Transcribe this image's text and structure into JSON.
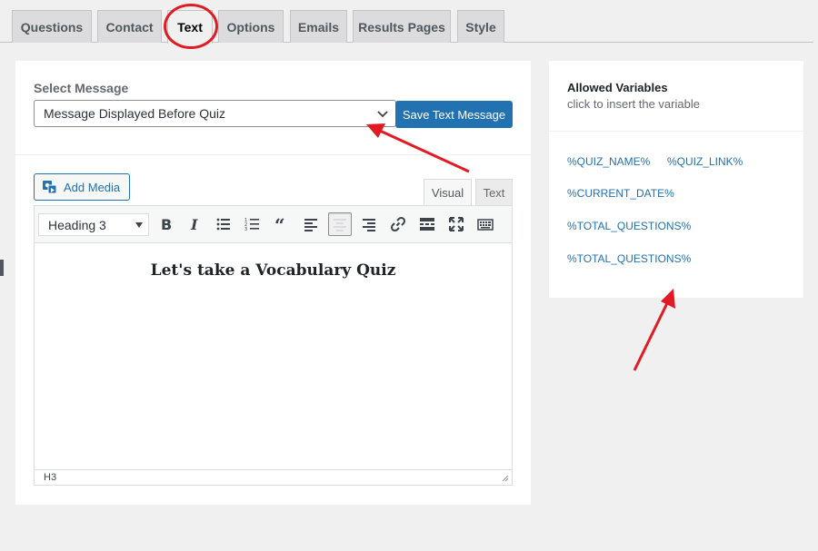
{
  "tabs": [
    {
      "label": "Questions",
      "active": false
    },
    {
      "label": "Contact",
      "active": false
    },
    {
      "label": "Text",
      "active": true
    },
    {
      "label": "Options",
      "active": false
    },
    {
      "label": "Emails",
      "active": false
    },
    {
      "label": "Results Pages",
      "active": false
    },
    {
      "label": "Style",
      "active": false
    }
  ],
  "message_section": {
    "label": "Select Message",
    "selected_value": "Message Displayed Before Quiz",
    "save_label": "Save Text Message"
  },
  "editor": {
    "add_media_label": "Add Media",
    "mode_visual": "Visual",
    "mode_text": "Text",
    "format_value": "Heading 3",
    "content_heading": "Let's take a Vocabulary Quiz",
    "status_path": "H3",
    "toolbar_icons": [
      "bold-icon",
      "italic-icon",
      "bullet-list-icon",
      "numbered-list-icon",
      "blockquote-icon",
      "align-left-icon",
      "align-center-icon",
      "align-right-icon",
      "link-icon",
      "read-more-icon",
      "fullscreen-icon",
      "keyboard-icon"
    ],
    "active_tool": "align-center-icon"
  },
  "allowed_variables": {
    "title": "Allowed Variables",
    "subtitle": "click to insert the variable",
    "items": [
      "%QUIZ_NAME%",
      "%QUIZ_LINK%",
      "%CURRENT_DATE%",
      "%TOTAL_QUESTIONS%",
      "%TOTAL_QUESTIONS%"
    ]
  },
  "colors": {
    "accent": "#2271b1",
    "annotation": "#e01b24",
    "background": "#f0f0f1"
  }
}
